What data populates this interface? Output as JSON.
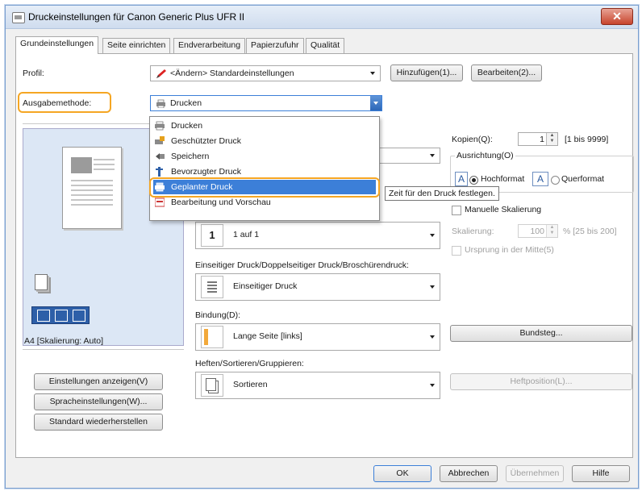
{
  "window": {
    "title": "Druckeinstellungen für Canon Generic Plus UFR II",
    "close": "✕"
  },
  "tabs": [
    {
      "label": "Grundeinstellungen",
      "active": true
    },
    {
      "label": "Seite einrichten",
      "active": false
    },
    {
      "label": "Endverarbeitung",
      "active": false
    },
    {
      "label": "Papierzufuhr",
      "active": false
    },
    {
      "label": "Qualität",
      "active": false
    }
  ],
  "profile": {
    "label": "Profil:",
    "value": "<Ändern> Standardeinstellungen",
    "add_button": "Hinzufügen(1)...",
    "edit_button": "Bearbeiten(2)..."
  },
  "output": {
    "label": "Ausgabemethode:",
    "value": "Drucken",
    "options": [
      {
        "label": "Drucken",
        "icon": "printer-icon"
      },
      {
        "label": "Geschützter Druck",
        "icon": "secure-print-icon"
      },
      {
        "label": "Speichern",
        "icon": "store-icon"
      },
      {
        "label": "Bevorzugter Druck",
        "icon": "priority-print-icon"
      },
      {
        "label": "Geplanter Druck",
        "icon": "scheduled-print-icon",
        "selected": true
      },
      {
        "label": "Bearbeitung und Vorschau",
        "icon": "edit-preview-icon"
      }
    ],
    "tooltip": "Zeit für den Druck festlegen."
  },
  "preview": {
    "caption": "A4 [Skalierung: Auto]"
  },
  "left_buttons": {
    "show_settings": "Einstellungen anzeigen(V)",
    "language": "Spracheinstellungen(W)...",
    "restore": "Standard wiederherstellen"
  },
  "copies": {
    "label": "Kopien(Q):",
    "value": "1",
    "range": "[1 bis 9999]"
  },
  "orientation": {
    "label": "Ausrichtung(O)",
    "portrait_glyph": "A",
    "portrait": "Hochformat",
    "landscape_glyph": "A",
    "landscape": "Querformat",
    "selected": "portrait"
  },
  "scaling": {
    "manual_label": "Manuelle Skalierung",
    "scale_label": "Skalierung:",
    "scale_value": "100",
    "scale_range": "% [25 bis 200]",
    "origin_label": "Ursprung in der Mitte(5)"
  },
  "layout": {
    "glyph": "1",
    "value": "1 auf 1"
  },
  "duplex": {
    "label": "Einseitiger Druck/Doppelseitiger Druck/Broschürendruck:",
    "value": "Einseitiger Druck"
  },
  "binding": {
    "label": "Bindung(D):",
    "value": "Lange Seite [links]",
    "button": "Bundsteg..."
  },
  "finishing": {
    "label": "Heften/Sortieren/Gruppieren:",
    "value": "Sortieren",
    "button": "Heftposition(L)..."
  },
  "footer": {
    "ok": "OK",
    "cancel": "Abbrechen",
    "apply": "Übernehmen",
    "help": "Hilfe"
  },
  "colors": {
    "highlight": "#f5a623",
    "selection": "#3c7fd8",
    "preview_bg": "#dce7f5"
  }
}
